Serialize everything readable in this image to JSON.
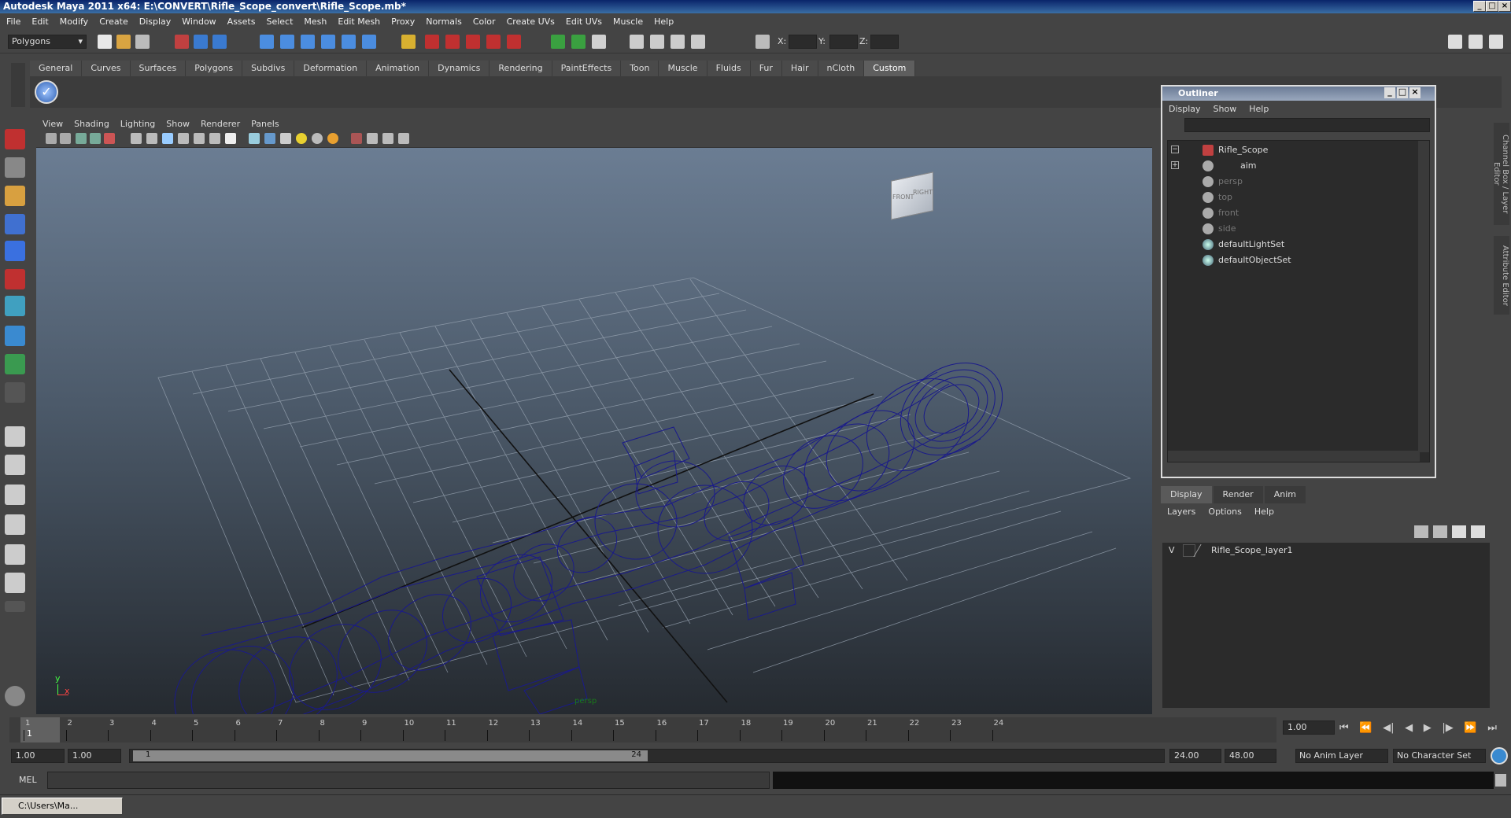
{
  "window": {
    "title": "Autodesk Maya 2011 x64: E:\\CONVERT\\Rifle_Scope_convert\\Rifle_Scope.mb*"
  },
  "menus": [
    "File",
    "Edit",
    "Modify",
    "Create",
    "Display",
    "Window",
    "Assets",
    "Select",
    "Mesh",
    "Edit Mesh",
    "Proxy",
    "Normals",
    "Color",
    "Create UVs",
    "Edit UVs",
    "Muscle",
    "Help"
  ],
  "status_line": {
    "mode": "Polygons",
    "x_label": "X:",
    "y_label": "Y:",
    "z_label": "Z:"
  },
  "shelf_tabs": [
    "General",
    "Curves",
    "Surfaces",
    "Polygons",
    "Subdivs",
    "Deformation",
    "Animation",
    "Dynamics",
    "Rendering",
    "PaintEffects",
    "Toon",
    "Muscle",
    "Fluids",
    "Fur",
    "Hair",
    "nCloth",
    "Custom"
  ],
  "shelf_active_tab": "Custom",
  "viewport": {
    "menus": [
      "View",
      "Shading",
      "Lighting",
      "Show",
      "Renderer",
      "Panels"
    ],
    "view_cube_labels": [
      "FRONT",
      "RIGHT"
    ],
    "camera_label": "persp",
    "axis": {
      "x": "x",
      "y": "y"
    }
  },
  "outliner": {
    "title": "Outliner",
    "menus": [
      "Display",
      "Show",
      "Help"
    ],
    "items": [
      {
        "label": "Rifle_Scope",
        "icon": "mesh-icon",
        "dim": false
      },
      {
        "label": "aim",
        "icon": "camera-icon",
        "dim": false
      },
      {
        "label": "persp",
        "icon": "camera-icon",
        "dim": true
      },
      {
        "label": "top",
        "icon": "camera-icon",
        "dim": true
      },
      {
        "label": "front",
        "icon": "camera-icon",
        "dim": true
      },
      {
        "label": "side",
        "icon": "camera-icon",
        "dim": true
      },
      {
        "label": "defaultLightSet",
        "icon": "set-icon",
        "dim": false
      },
      {
        "label": "defaultObjectSet",
        "icon": "set-icon",
        "dim": false
      }
    ]
  },
  "side_tabs": [
    "Channel Box / Layer Editor",
    "Attribute Editor"
  ],
  "layer_editor": {
    "tabs": [
      "Display",
      "Render",
      "Anim"
    ],
    "active_tab": "Display",
    "menus": [
      "Layers",
      "Options",
      "Help"
    ],
    "layers": [
      {
        "visible": "V",
        "name": "Rifle_Scope_layer1"
      }
    ]
  },
  "time_slider": {
    "ticks": [
      "1",
      "2",
      "3",
      "4",
      "5",
      "6",
      "7",
      "8",
      "9",
      "10",
      "11",
      "12",
      "13",
      "14",
      "15",
      "16",
      "17",
      "18",
      "19",
      "20",
      "21",
      "22",
      "23",
      "24"
    ],
    "current_marker": "1",
    "current_time": "1.00"
  },
  "range_slider": {
    "start": "1.00",
    "anim_start": "1.00",
    "range_start_label": "1",
    "range_end_label": "24",
    "anim_end": "24.00",
    "end": "48.00",
    "anim_layer": "No Anim Layer",
    "character_set": "No Character Set"
  },
  "command_line": {
    "label": "MEL"
  },
  "taskbar": {
    "label": "C:\\Users\\Ma..."
  },
  "colors": {
    "wireframe": "#1a1a8a",
    "grid": "#9aa6b4",
    "title_bar": "#0a246a"
  }
}
